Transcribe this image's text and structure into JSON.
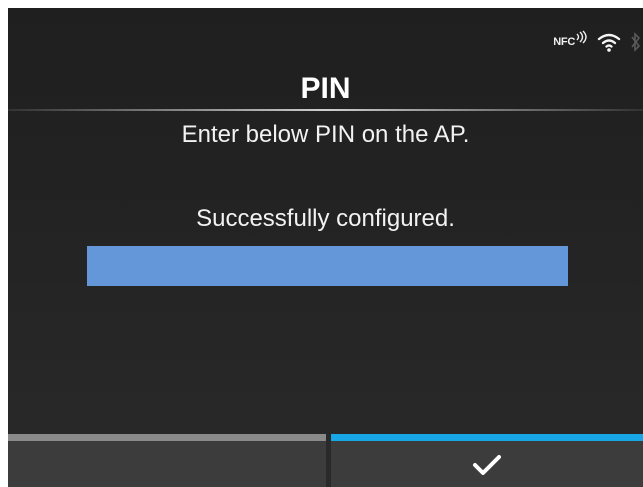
{
  "status_bar": {
    "nfc_label": "NFC",
    "icons": [
      "nfc-icon",
      "wifi-icon",
      "bluetooth-icon"
    ]
  },
  "header": {
    "title": "PIN"
  },
  "main": {
    "instruction": "Enter below PIN on the AP.",
    "status_message": "Successfully configured.",
    "progress_fraction": 1.0
  },
  "softkeys": {
    "left": {
      "label": ""
    },
    "right": {
      "icon": "checkmark-icon"
    }
  },
  "colors": {
    "background": "#222222",
    "progress_fill": "#6497d9",
    "confirm_accent": "#17a7e6",
    "left_key_accent": "#8a8a8a",
    "text": "#ffffff"
  }
}
